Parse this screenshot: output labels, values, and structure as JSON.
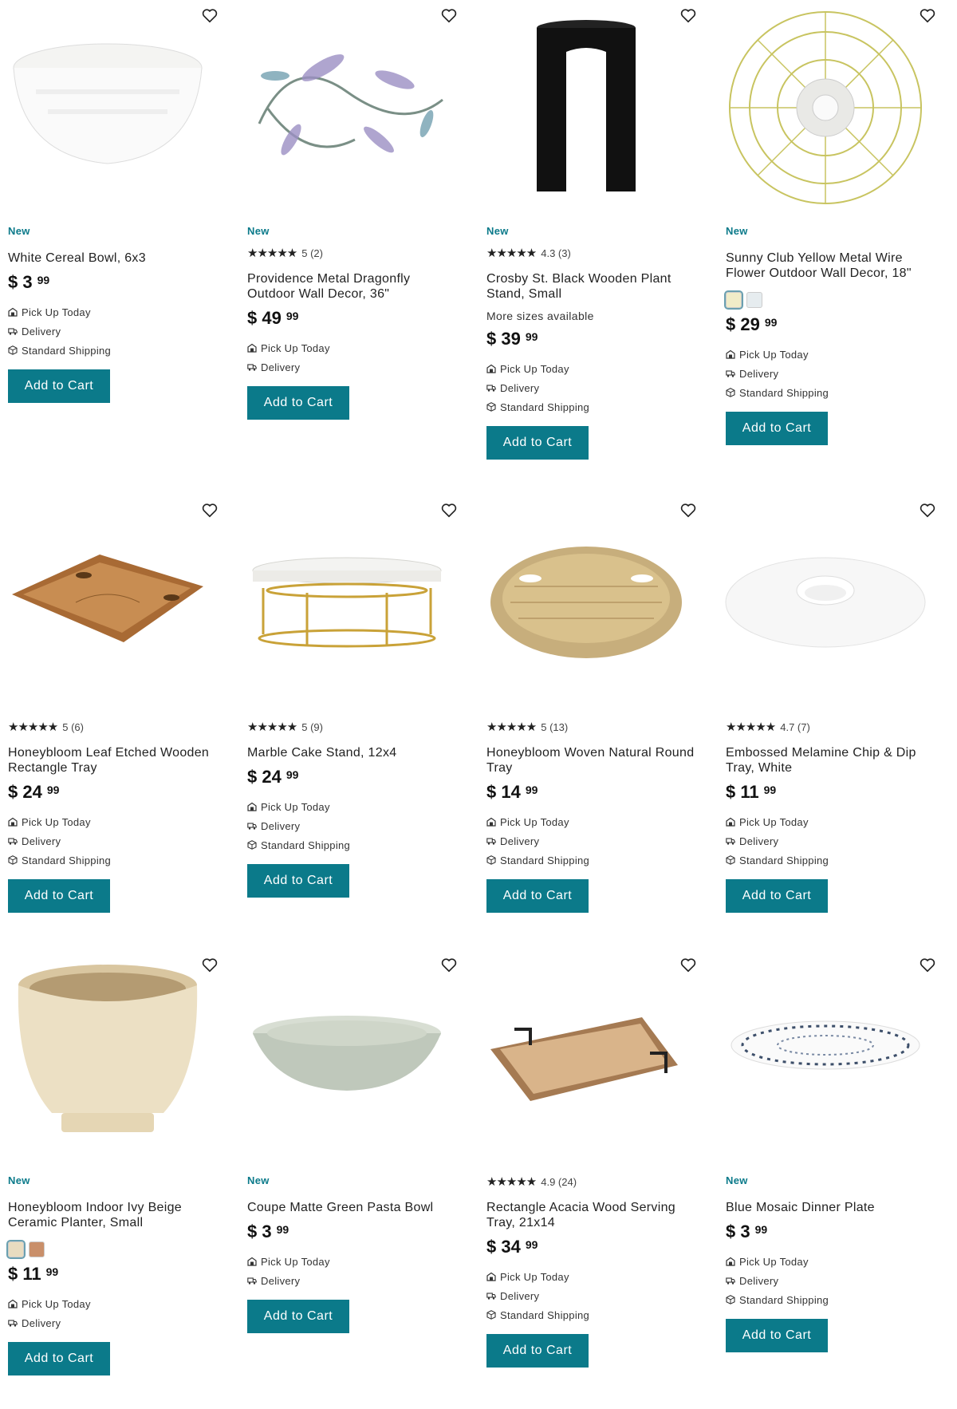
{
  "colors": {
    "accent": "#0b7a8a",
    "text": "#1a1a1a"
  },
  "common": {
    "new_label": "New",
    "pickup_label": "Pick Up Today",
    "delivery_label": "Delivery",
    "shipping_label": "Standard Shipping",
    "cart_label": "Add to Cart"
  },
  "products": [
    {
      "title": "White Cereal Bowl, 6x3",
      "badge": "New",
      "rating": null,
      "reviews": null,
      "dollars": "3",
      "cents": "99",
      "extra": null,
      "options": [
        "pickup",
        "delivery",
        "shipping"
      ],
      "swatches": [],
      "image": "bowl-white"
    },
    {
      "title": "Providence Metal Dragonfly Outdoor Wall Decor, 36\"",
      "badge": "New",
      "rating": "5",
      "reviews": "(2)",
      "dollars": "49",
      "cents": "99",
      "extra": null,
      "options": [
        "pickup",
        "delivery"
      ],
      "swatches": [],
      "image": "dragonfly"
    },
    {
      "title": "Crosby St. Black Wooden Plant Stand, Small",
      "badge": "New",
      "rating": "4.3",
      "reviews": "(3)",
      "dollars": "39",
      "cents": "99",
      "extra": "More sizes available",
      "options": [
        "pickup",
        "delivery",
        "shipping"
      ],
      "swatches": [],
      "image": "plant-stand"
    },
    {
      "title": "Sunny Club Yellow Metal Wire Flower Outdoor Wall Decor, 18\"",
      "badge": "New",
      "rating": null,
      "reviews": null,
      "dollars": "29",
      "cents": "99",
      "extra": null,
      "options": [
        "pickup",
        "delivery",
        "shipping"
      ],
      "swatches": [
        "#f0ecc8",
        "#e6ecef"
      ],
      "image": "wire-flower"
    },
    {
      "title": "Honeybloom Leaf Etched Wooden Rectangle Tray",
      "badge": null,
      "rating": "5",
      "reviews": "(6)",
      "dollars": "24",
      "cents": "99",
      "extra": null,
      "options": [
        "pickup",
        "delivery",
        "shipping"
      ],
      "swatches": [],
      "image": "wood-tray"
    },
    {
      "title": "Marble Cake Stand, 12x4",
      "badge": null,
      "rating": "5",
      "reviews": "(9)",
      "dollars": "24",
      "cents": "99",
      "extra": null,
      "options": [
        "pickup",
        "delivery",
        "shipping"
      ],
      "swatches": [],
      "image": "cake-stand"
    },
    {
      "title": "Honeybloom Woven Natural Round Tray",
      "badge": null,
      "rating": "5",
      "reviews": "(13)",
      "dollars": "14",
      "cents": "99",
      "extra": null,
      "options": [
        "pickup",
        "delivery",
        "shipping"
      ],
      "swatches": [],
      "image": "woven-tray"
    },
    {
      "title": "Embossed Melamine Chip & Dip Tray, White",
      "badge": null,
      "rating": "4.7",
      "reviews": "(7)",
      "dollars": "11",
      "cents": "99",
      "extra": null,
      "options": [
        "pickup",
        "delivery",
        "shipping"
      ],
      "swatches": [],
      "image": "chip-dip"
    },
    {
      "title": "Honeybloom Indoor Ivy Beige Ceramic Planter, Small",
      "badge": "New",
      "rating": null,
      "reviews": null,
      "dollars": "11",
      "cents": "99",
      "extra": null,
      "options": [
        "pickup",
        "delivery"
      ],
      "swatches": [
        "#e8dcc0",
        "#c98f6a"
      ],
      "image": "planter"
    },
    {
      "title": "Coupe Matte Green Pasta Bowl",
      "badge": "New",
      "rating": null,
      "reviews": null,
      "dollars": "3",
      "cents": "99",
      "extra": null,
      "options": [
        "pickup",
        "delivery"
      ],
      "swatches": [],
      "image": "pasta-bowl"
    },
    {
      "title": "Rectangle Acacia Wood Serving Tray, 21x14",
      "badge": null,
      "rating": "4.9",
      "reviews": "(24)",
      "dollars": "34",
      "cents": "99",
      "extra": null,
      "options": [
        "pickup",
        "delivery",
        "shipping"
      ],
      "swatches": [],
      "image": "acacia-tray"
    },
    {
      "title": "Blue Mosaic Dinner Plate",
      "badge": "New",
      "rating": null,
      "reviews": null,
      "dollars": "3",
      "cents": "99",
      "extra": null,
      "options": [
        "pickup",
        "delivery",
        "shipping"
      ],
      "swatches": [],
      "image": "mosaic-plate"
    }
  ]
}
